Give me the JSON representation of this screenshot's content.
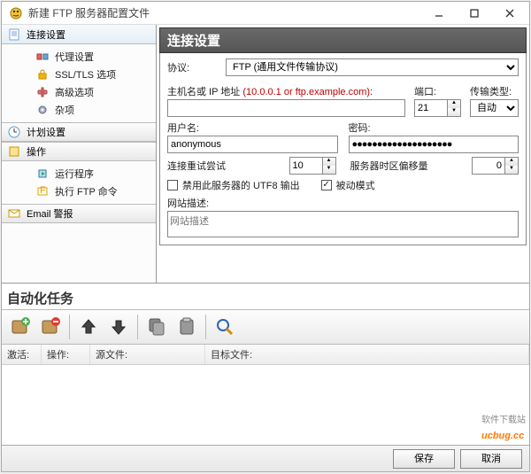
{
  "window": {
    "title": "新建 FTP 服务器配置文件"
  },
  "sidebar": {
    "conn_settings": "连接设置",
    "items": [
      "代理设置",
      "SSL/TLS 选项",
      "高级选项",
      "杂项"
    ],
    "schedule": "计划设置",
    "actions": "操作",
    "action_items": [
      "运行程序",
      "执行 FTP 命令"
    ],
    "email": "Email 警报"
  },
  "content": {
    "section_title": "连接设置",
    "protocol_label": "协议:",
    "protocol_value": "FTP (通用文件传输协议)",
    "host_label": "主机名或 IP 地址",
    "host_hint": "(10.0.0.1 or ftp.example.com):",
    "host_value": "",
    "port_label": "端口:",
    "port_value": "21",
    "transfer_label": "传输类型:",
    "transfer_value": "自动",
    "user_label": "用户名:",
    "user_value": "anonymous",
    "pass_label": "密码:",
    "pass_value": "●●●●●●●●●●●●●●●●●●●●",
    "retry_label": "连接重试尝试",
    "retry_value": "10",
    "tz_label": "服务器时区偏移量",
    "tz_value": "0",
    "utf8_label": "禁用此服务器的 UTF8 输出",
    "passive_label": "被动模式",
    "site_desc_label": "网站描述:",
    "site_desc_placeholder": "网站描述"
  },
  "auto": {
    "title": "自动化任务",
    "cols": [
      "激活:",
      "操作:",
      "源文件:",
      "目标文件:"
    ]
  },
  "footer": {
    "save": "保存",
    "cancel": "取消"
  },
  "watermark": {
    "small": "软件下载站",
    "big": "ucbug.cc"
  }
}
